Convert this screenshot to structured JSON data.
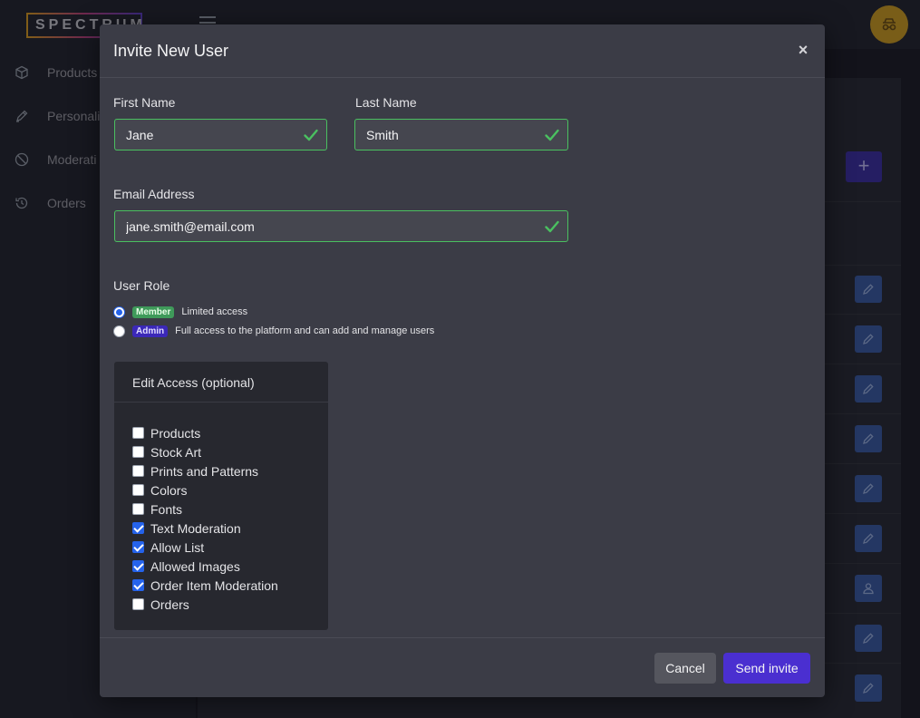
{
  "app": {
    "logo_text": "SPECTRUM",
    "nav": [
      {
        "label": "Products",
        "icon": "cube-icon"
      },
      {
        "label": "Personali",
        "icon": "pen-icon"
      },
      {
        "label": "Moderati",
        "icon": "block-icon"
      },
      {
        "label": "Orders",
        "icon": "history-icon"
      }
    ],
    "add_button": "+"
  },
  "modal": {
    "title": "Invite New User",
    "close": "×",
    "first_name": {
      "label": "First Name",
      "value": "Jane"
    },
    "last_name": {
      "label": "Last Name",
      "value": "Smith"
    },
    "email": {
      "label": "Email Address",
      "value": "jane.smith@email.com"
    },
    "role": {
      "label": "User Role",
      "options": [
        {
          "badge": "Member",
          "description": "Limited access",
          "selected": true
        },
        {
          "badge": "Admin",
          "description": "Full access to the platform and can add and manage users",
          "selected": false
        }
      ]
    },
    "access": {
      "title": "Edit Access (optional)",
      "items": [
        {
          "label": "Products",
          "checked": false
        },
        {
          "label": "Stock Art",
          "checked": false
        },
        {
          "label": "Prints and Patterns",
          "checked": false
        },
        {
          "label": "Colors",
          "checked": false
        },
        {
          "label": "Fonts",
          "checked": false
        },
        {
          "label": "Text Moderation",
          "checked": true
        },
        {
          "label": "Allow List",
          "checked": true
        },
        {
          "label": "Allowed Images",
          "checked": true
        },
        {
          "label": "Order Item Moderation",
          "checked": true
        },
        {
          "label": "Orders",
          "checked": false
        }
      ]
    },
    "cancel_label": "Cancel",
    "send_label": "Send invite"
  },
  "colors": {
    "valid": "#4ac060",
    "primary": "#4a2fd0",
    "member": "#3f9a5a",
    "admin": "#3b28b8"
  }
}
